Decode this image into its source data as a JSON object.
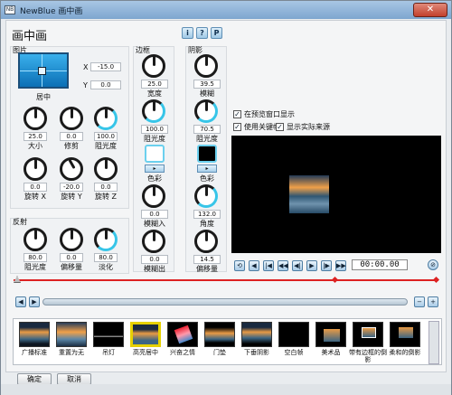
{
  "window": {
    "title": "NewBlue 画中画",
    "app_icon": "NB",
    "close": "✕"
  },
  "heading": "画中画",
  "help_buttons": [
    "i",
    "?",
    "P"
  ],
  "picture": {
    "group_label": "图片",
    "position": {
      "label": "居中",
      "x_label": "X",
      "x": "-15.0",
      "y_label": "Y",
      "y": "0.0"
    },
    "knobs": [
      {
        "value": "25.0",
        "label": "大小"
      },
      {
        "value": "0.0",
        "label": "修剪"
      },
      {
        "value": "100.0",
        "label": "阻光度"
      },
      {
        "value": "0.0",
        "label": "旋转 X"
      },
      {
        "value": "-20.0",
        "label": "旋转 Y"
      },
      {
        "value": "0.0",
        "label": "旋转 Z"
      }
    ]
  },
  "reflection": {
    "group_label": "反射",
    "knobs": [
      {
        "value": "80.0",
        "label": "阻光度"
      },
      {
        "value": "0.0",
        "label": "偏移量"
      },
      {
        "value": "80.0",
        "label": "淡化"
      }
    ]
  },
  "border": {
    "group_label": "边框",
    "knobs": [
      {
        "value": "25.0",
        "label": "宽度"
      },
      {
        "value": "100.0",
        "label": "阻光度"
      },
      {
        "value": "0.0",
        "label": "模糊入"
      },
      {
        "value": "0.0",
        "label": "模糊出"
      }
    ],
    "color_label": "色彩",
    "color": "#ffffff"
  },
  "shadow": {
    "group_label": "阴影",
    "knobs": [
      {
        "value": "39.5",
        "label": "模糊"
      },
      {
        "value": "70.5",
        "label": "阻光度"
      },
      {
        "value": "132.0",
        "label": "角度"
      },
      {
        "value": "14.5",
        "label": "偏移量"
      }
    ],
    "color_label": "色彩",
    "color": "#000000"
  },
  "options": [
    {
      "label": "在预览窗口显示",
      "checked": true
    },
    {
      "label": "使用关键帧",
      "checked": true
    },
    {
      "label": "显示实际来源",
      "checked": true
    }
  ],
  "transport": {
    "timecode": "00:00.00",
    "buttons": [
      "⟲",
      "◀",
      "|◀",
      "◀◀",
      "◀|",
      "▶",
      "|▶",
      "▶▶",
      "▶|"
    ]
  },
  "presets": [
    {
      "name": "广播标准"
    },
    {
      "name": "重置为无"
    },
    {
      "name": "吊灯"
    },
    {
      "name": "高亮居中"
    },
    {
      "name": "兴奋之情"
    },
    {
      "name": "门垫"
    },
    {
      "name": "下垂阴影"
    },
    {
      "name": "空白帧"
    },
    {
      "name": "美术品"
    },
    {
      "name": "带有边框的倒影"
    },
    {
      "name": "柔和的倒影"
    }
  ],
  "footer": {
    "ok": "确定",
    "cancel": "取消"
  }
}
